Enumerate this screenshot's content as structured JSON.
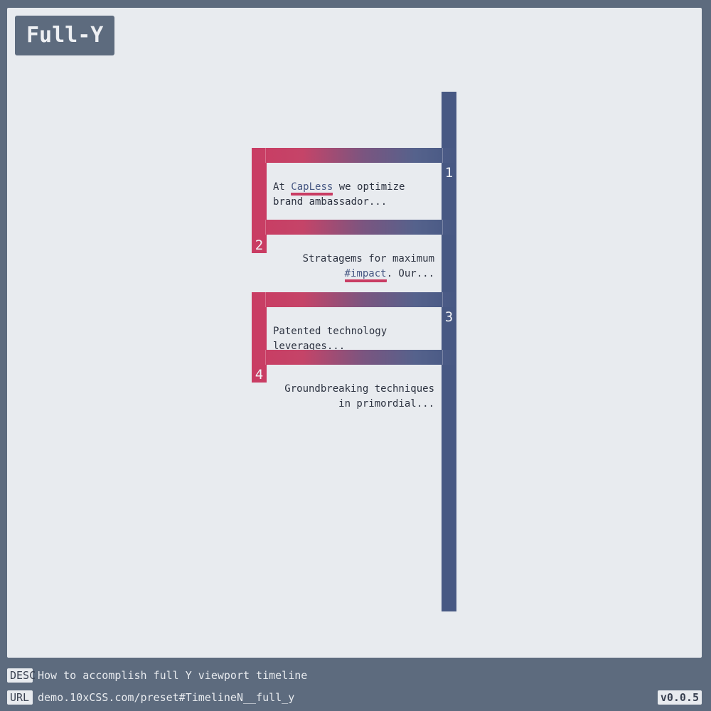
{
  "header": {
    "title": "Full-Y"
  },
  "timeline": {
    "items": [
      {
        "number": "1",
        "text_before": "At ",
        "highlight": "CapLess",
        "text_after": " we optimize brand ambassador..."
      },
      {
        "number": "2",
        "text_before": "Stratagems for maximum ",
        "highlight": "#impact",
        "text_after": ". Our..."
      },
      {
        "number": "3",
        "text": "Patented technology leverages..."
      },
      {
        "number": "4",
        "text": "Groundbreaking techniques in primordial..."
      }
    ]
  },
  "footer": {
    "desc_label": "DESC",
    "desc_text": "How to accomplish full Y viewport timeline",
    "url_label": "URL",
    "url_text": "demo.10xCSS.com/preset#TimelineN__full_y",
    "version": "v0.0.5"
  },
  "colors": {
    "accent_pink": "#c93c63",
    "accent_blue": "#475883",
    "background": "#5d6b7e",
    "stage": "#e8ebef"
  }
}
